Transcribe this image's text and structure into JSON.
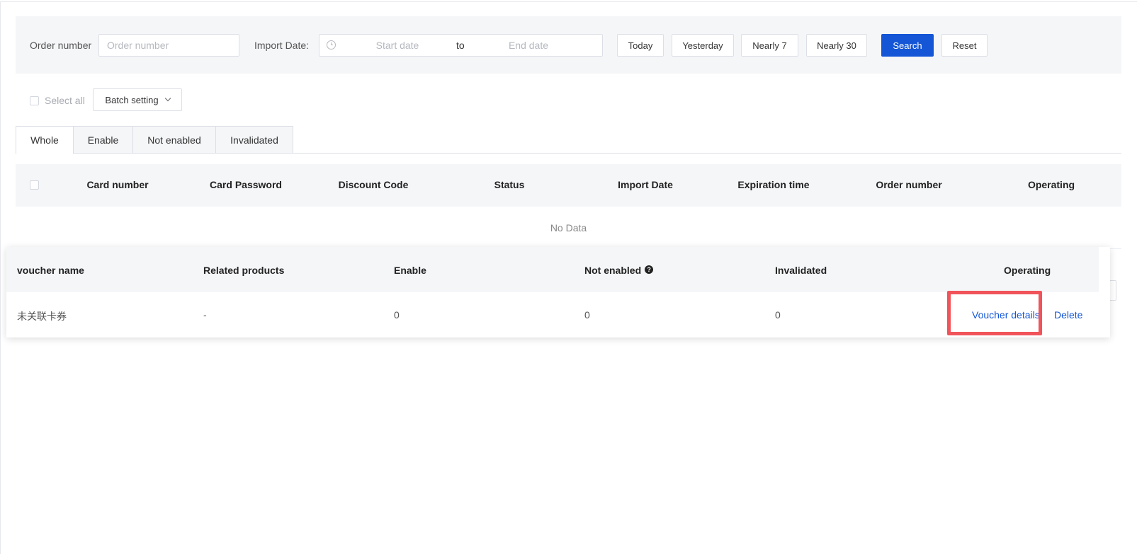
{
  "filters": {
    "order_number_label": "Order number",
    "order_number_placeholder": "Order number",
    "import_date_label": "Import Date:",
    "start_date_placeholder": "Start date",
    "range_separator": "to",
    "end_date_placeholder": "End date",
    "quick_ranges": [
      "Today",
      "Yesterday",
      "Nearly 7",
      "Nearly 30"
    ],
    "search_label": "Search",
    "reset_label": "Reset"
  },
  "toolbar": {
    "select_all_label": "Select all",
    "batch_setting_label": "Batch setting"
  },
  "tabs": [
    {
      "label": "Whole",
      "active": true
    },
    {
      "label": "Enable",
      "active": false
    },
    {
      "label": "Not enabled",
      "active": false
    },
    {
      "label": "Invalidated",
      "active": false
    }
  ],
  "main_table": {
    "columns": [
      "Card number",
      "Card Password",
      "Discount Code",
      "Status",
      "Import Date",
      "Expiration time",
      "Order number",
      "Operating"
    ],
    "empty_text": "No Data"
  },
  "voucher_table": {
    "columns": [
      "voucher name",
      "Related products",
      "Enable",
      "Not enabled",
      "Invalidated",
      "Operating"
    ],
    "rows": [
      {
        "voucher_name": "未关联卡券",
        "related_products": "-",
        "enable": "0",
        "not_enabled": "0",
        "invalidated": "0",
        "details_label": "Voucher details",
        "delete_label": "Delete"
      }
    ]
  },
  "colors": {
    "primary": "#1456d6",
    "highlight": "#f0545a",
    "header_bg": "#f5f6f8"
  }
}
